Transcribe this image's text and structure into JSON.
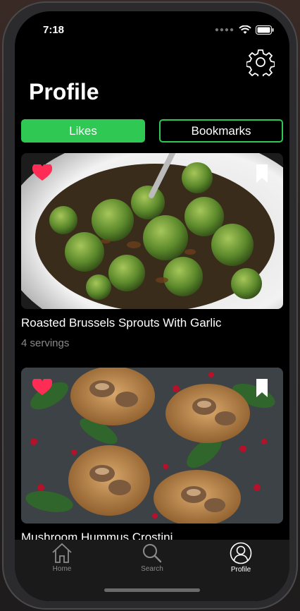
{
  "status": {
    "time": "7:18"
  },
  "header": {
    "title": "Profile"
  },
  "segments": {
    "likes": "Likes",
    "bookmarks": "Bookmarks",
    "selected": "Likes"
  },
  "recipes": [
    {
      "title": "Roasted Brussels Sprouts With Garlic",
      "servings": "4 servings",
      "liked": true,
      "bookmarked": false
    },
    {
      "title": "Mushroom Hummus Crostini",
      "liked": true,
      "bookmarked": false
    }
  ],
  "tabbar": {
    "items": [
      {
        "label": "Home",
        "icon": "house-icon"
      },
      {
        "label": "Search",
        "icon": "magnifier-icon"
      },
      {
        "label": "Profile",
        "icon": "person-circle-icon",
        "active": true
      }
    ]
  },
  "colors": {
    "accent": "#2ec852",
    "heart": "#ff2d55",
    "background": "#000000"
  }
}
